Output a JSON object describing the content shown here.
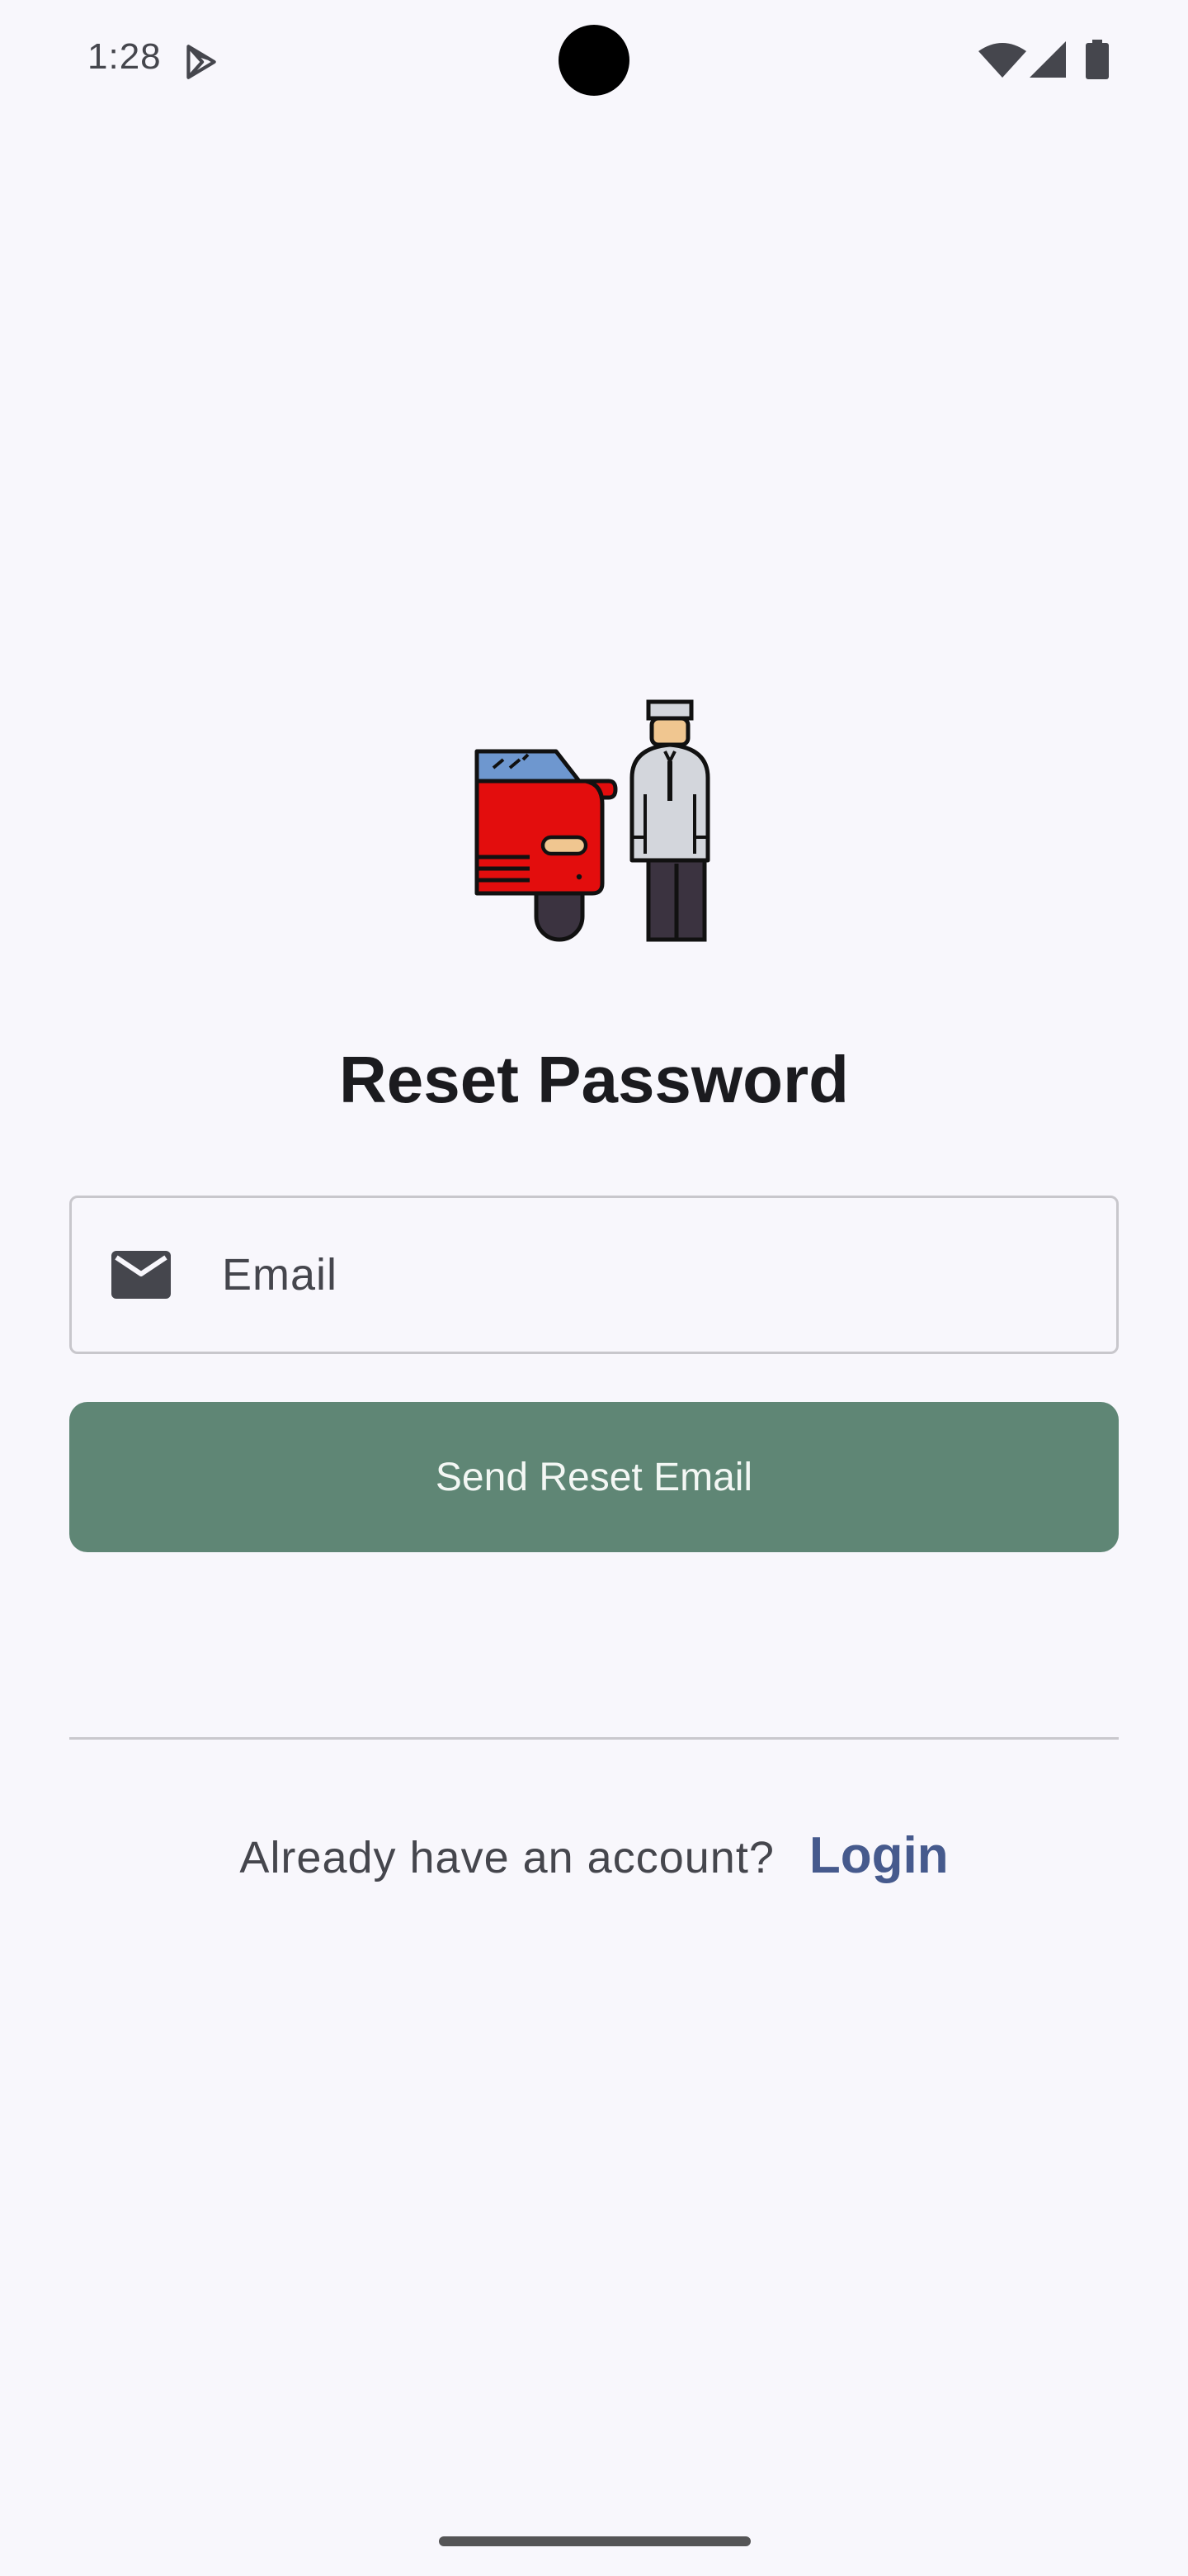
{
  "status_bar": {
    "time": "1:28",
    "icons": [
      "play-store-icon",
      "wifi-icon",
      "signal-icon",
      "battery-icon"
    ]
  },
  "illustration": {
    "icon": "car-valet-icon",
    "colors": {
      "car_body": "#e30d0d",
      "windshield": "#6e97cf",
      "valet_shirt": "#d3d6dc",
      "valet_pants": "#3b3340",
      "skin": "#f0c690"
    }
  },
  "title": "Reset Password",
  "email_field": {
    "icon": "mail-icon",
    "placeholder": "Email",
    "value": ""
  },
  "send_button": {
    "label": "Send Reset Email",
    "color": "#5f8675"
  },
  "footer": {
    "prompt": "Already have an account?",
    "login_label": "Login",
    "link_color": "#465a8d"
  }
}
